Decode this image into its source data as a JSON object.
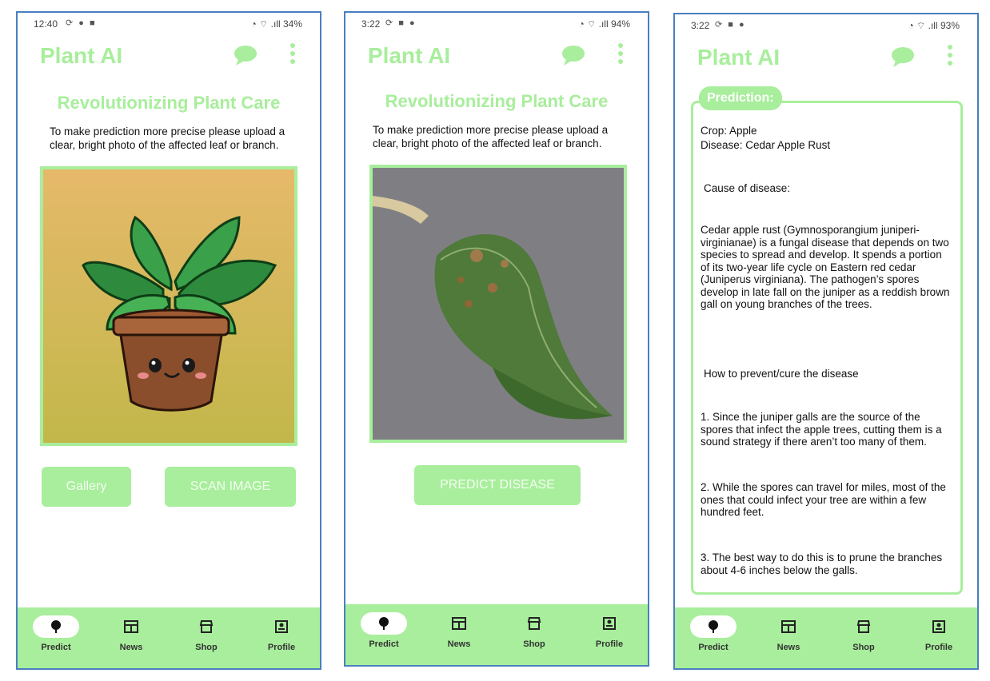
{
  "screens": [
    {
      "status": {
        "time": "12:40",
        "battery": "34%"
      },
      "app_title": "Plant AI",
      "heading": "Revolutionizing Plant Care",
      "instructions": "To make prediction more precise please upload a clear, bright photo of the affected leaf or branch.",
      "buttons": {
        "gallery": "Gallery",
        "scan": "SCAN IMAGE"
      }
    },
    {
      "status": {
        "time": "3:22",
        "battery": "94%"
      },
      "app_title": "Plant AI",
      "heading": "Revolutionizing Plant Care",
      "instructions": "To make prediction more precise please upload a clear, bright photo of the affected leaf or branch.",
      "buttons": {
        "predict": "PREDICT DISEASE"
      }
    },
    {
      "status": {
        "time": "3:22",
        "battery": "93%"
      },
      "app_title": "Plant AI",
      "prediction_label": "Prediction:",
      "crop": "Crop: Apple",
      "disease": "Disease: Cedar Apple Rust",
      "cause_heading": "Cause of disease:",
      "cause_text": "Cedar apple rust (Gymnosporangium juniperi-virginianae) is a fungal disease that depends on two species to spread and develop. It spends a portion of its two-year life cycle on Eastern red cedar (Juniperus virginiana). The pathogen’s spores develop in late fall on the juniper as a reddish brown gall on young branches of the trees.",
      "prevent_heading": "How to prevent/cure the disease",
      "tip1": "1. Since the juniper galls are the source of the spores that infect the apple trees, cutting them is a sound strategy if there aren’t too many of them.",
      "tip2": "2. While the spores can travel for miles, most of the ones that could infect your tree are within a few hundred feet.",
      "tip3": "3. The best way to do this is to prune the branches about 4-6 inches below the galls."
    }
  ],
  "nav": {
    "predict": "Predict",
    "news": "News",
    "shop": "Shop",
    "profile": "Profile"
  },
  "colors": {
    "accent": "#a8ee9c",
    "frame": "#4a7fc1"
  }
}
